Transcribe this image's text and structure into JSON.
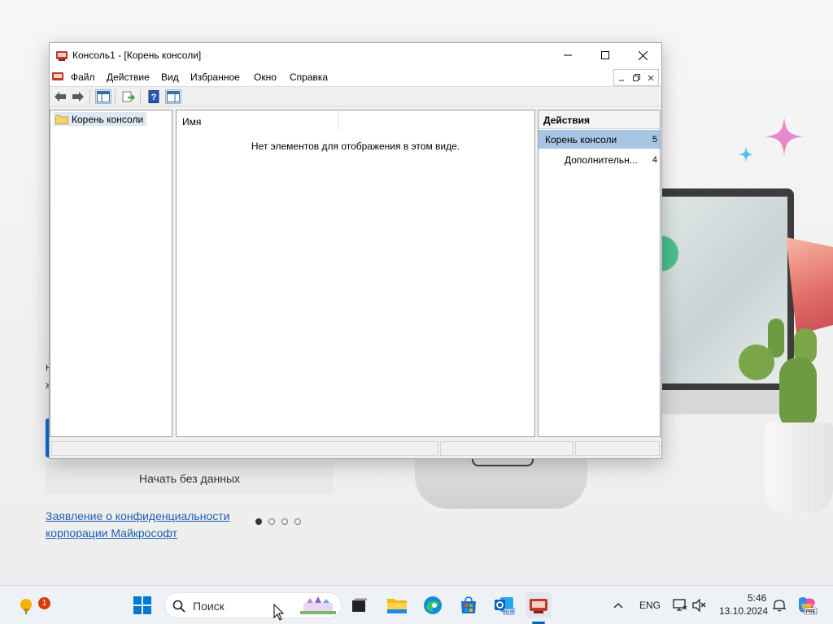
{
  "window": {
    "title": "Консоль1 - [Корень консоли]",
    "menu": [
      "Файл",
      "Действие",
      "Вид",
      "Избранное",
      "Окно",
      "Справка"
    ]
  },
  "tree": {
    "root_label": "Корень консоли"
  },
  "center": {
    "column_name": "Имя",
    "empty_message": "Нет элементов для отображения в этом виде."
  },
  "actions": {
    "header": "Действия",
    "section_label": "Корень консоли",
    "more_label": "Дополнительн...",
    "section_arrow": "5",
    "more_arrow": "4"
  },
  "background": {
    "no_data_button": "Начать без данных",
    "privacy_line1": "Заявление о конфиденциальности",
    "privacy_line2": "корпорации Майкрософт",
    "page_dots": {
      "count": 4,
      "active": 1
    }
  },
  "taskbar": {
    "search_placeholder": "Поиск",
    "notification_badge": "1",
    "language": "ENG",
    "time": "5:46",
    "date": "13.10.2024"
  },
  "colors": {
    "accent": "#0067c0",
    "selection": "#a9c5e4",
    "taskbar": "#eef2f6"
  }
}
